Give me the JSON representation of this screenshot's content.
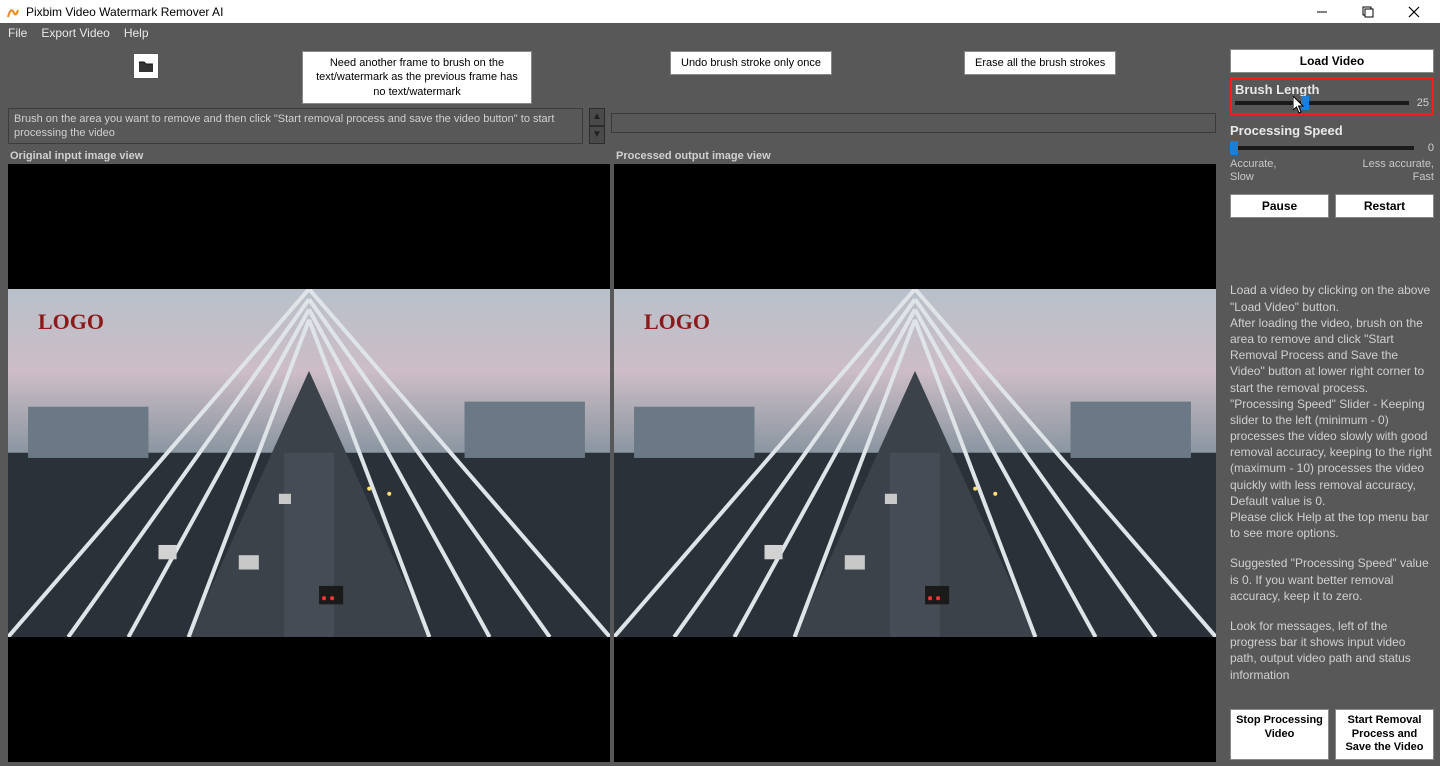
{
  "titlebar": {
    "title": "Pixbim Video Watermark Remover AI"
  },
  "menus": {
    "file": "File",
    "export": "Export Video",
    "help": "Help"
  },
  "toolbar": {
    "need_frame": "Need another frame to brush on the text/watermark as the previous frame has no text/watermark",
    "undo": "Undo brush stroke only once",
    "erase_all": "Erase all the brush strokes"
  },
  "instruction": "Brush on the area you want to remove and then click \"Start removal process and save the video button\" to start processing the video",
  "views": {
    "input_header": "Original input image view",
    "output_header": "Processed output image view",
    "logo_text": "LOGO"
  },
  "right": {
    "load_video": "Load Video",
    "brush_length_label": "Brush Length",
    "brush_length_value": "25",
    "processing_speed_label": "Processing Speed",
    "processing_speed_value": "0",
    "accurate_label": "Accurate,\nSlow",
    "fast_label": "Less accurate,\nFast",
    "pause": "Pause",
    "restart": "Restart",
    "help_p1": "Load a video by clicking on the above \"Load Video\" button.\nAfter loading the video, brush on the area to remove and click \"Start Removal Process and Save the Video\" button at lower right corner to start the removal process.\n\"Processing Speed\" Slider - Keeping slider to the left (minimum - 0) processes the video slowly with good removal accuracy, keeping to the right (maximum - 10) processes the video quickly with less removal accuracy, Default value is 0.\nPlease click Help at the top menu bar to see more options.",
    "help_p2": "Suggested \"Processing Speed\" value is 0. If you want better removal accuracy, keep it to zero.",
    "help_p3": "Look for messages, left of the progress bar it shows input video path, output video path and status information",
    "stop_btn": "Stop Processing Video",
    "start_btn": "Start Removal Process and Save the Video"
  }
}
